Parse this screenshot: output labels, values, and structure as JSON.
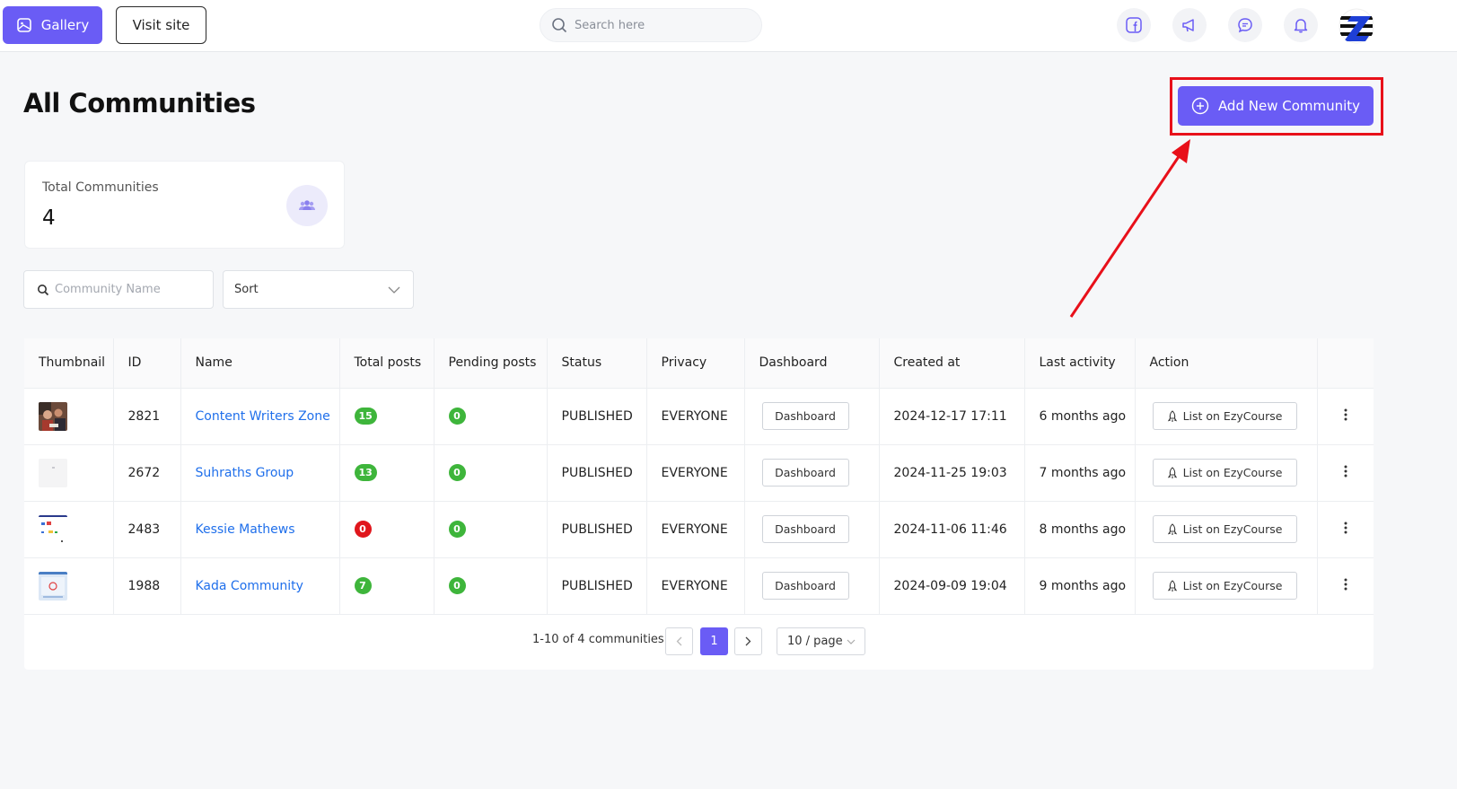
{
  "header": {
    "gallery_label": "Gallery",
    "visit_label": "Visit site",
    "search_placeholder": "Search here"
  },
  "page": {
    "title": "All Communities",
    "add_button_label": "Add New Community"
  },
  "stats": {
    "label": "Total Communities",
    "value": "4"
  },
  "filters": {
    "name_placeholder": "Community Name",
    "sort_label": "Sort"
  },
  "table": {
    "columns": [
      "Thumbnail",
      "ID",
      "Name",
      "Total posts",
      "Pending posts",
      "Status",
      "Privacy",
      "Dashboard",
      "Created at",
      "Last activity",
      "Action"
    ],
    "rows": [
      {
        "id": "2821",
        "name": "Content Writers Zone",
        "total_posts": "15",
        "pending_posts": "0",
        "status": "PUBLISHED",
        "privacy": "EVERYONE",
        "dashboard": "Dashboard",
        "created_at": "2024-12-17 17:11",
        "last_activity": "6 months ago",
        "action": "List on EzyCourse"
      },
      {
        "id": "2672",
        "name": "Suhraths Group",
        "total_posts": "13",
        "pending_posts": "0",
        "status": "PUBLISHED",
        "privacy": "EVERYONE",
        "dashboard": "Dashboard",
        "created_at": "2024-11-25 19:03",
        "last_activity": "7 months ago",
        "action": "List on EzyCourse"
      },
      {
        "id": "2483",
        "name": "Kessie Mathews",
        "total_posts": "0",
        "pending_posts": "0",
        "status": "PUBLISHED",
        "privacy": "EVERYONE",
        "dashboard": "Dashboard",
        "created_at": "2024-11-06 11:46",
        "last_activity": "8 months ago",
        "action": "List on EzyCourse"
      },
      {
        "id": "1988",
        "name": "Kada Community",
        "total_posts": "7",
        "pending_posts": "0",
        "status": "PUBLISHED",
        "privacy": "EVERYONE",
        "dashboard": "Dashboard",
        "created_at": "2024-09-09 19:04",
        "last_activity": "9 months ago",
        "action": "List on EzyCourse"
      }
    ]
  },
  "pagination": {
    "summary": "1-10 of 4 communities",
    "current_page": "1",
    "page_size": "10 / page"
  },
  "colors": {
    "accent": "#6a5cf5",
    "highlight": "#e8101a",
    "badge_green": "#3eb53b",
    "badge_red": "#e0161c",
    "link": "#1f6feb"
  }
}
